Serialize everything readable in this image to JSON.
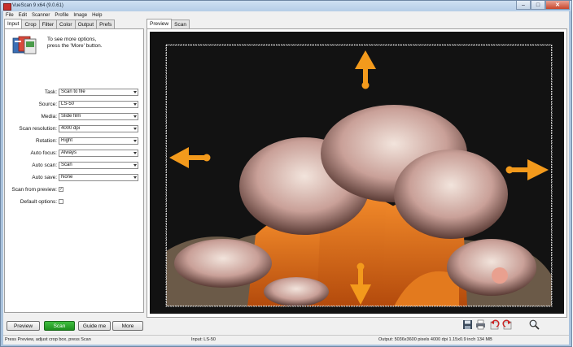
{
  "window": {
    "title": "VueScan 9 x64 (9.0.61)"
  },
  "menu": [
    "File",
    "Edit",
    "Scanner",
    "Profile",
    "Image",
    "Help"
  ],
  "left_tabs": [
    "Input",
    "Crop",
    "Filter",
    "Color",
    "Output",
    "Prefs"
  ],
  "right_tabs": [
    "Preview",
    "Scan"
  ],
  "hint": {
    "line1": "To see more options,",
    "line2": "press the 'More' button."
  },
  "fields": [
    {
      "label": "Task:",
      "value": "Scan to file"
    },
    {
      "label": "Source:",
      "value": "LS-50"
    },
    {
      "label": "Media:",
      "value": "Slide film"
    },
    {
      "label": "Scan resolution:",
      "value": "4000 dpi"
    },
    {
      "label": "Rotation:",
      "value": "Right"
    },
    {
      "label": "Auto focus:",
      "value": "Always"
    },
    {
      "label": "Auto scan:",
      "value": "Scan"
    },
    {
      "label": "Auto save:",
      "value": "None"
    }
  ],
  "checks": [
    {
      "label": "Scan from preview:",
      "checked": true,
      "mark": "✓"
    },
    {
      "label": "Default options:",
      "checked": false,
      "mark": ""
    }
  ],
  "buttons": {
    "preview": "Preview",
    "scan": "Scan",
    "guide": "Guide me",
    "more": "More"
  },
  "status": {
    "left": "Press Preview, adjust crop box, press Scan",
    "middle": "Input: LS-50",
    "right": "Output: 5036x3600 pixels 4000 dpi 1.15x0.9 inch 134 MB"
  },
  "colors": {
    "accent_arrow": "#f39a1c",
    "scan_button": "#22a022"
  }
}
